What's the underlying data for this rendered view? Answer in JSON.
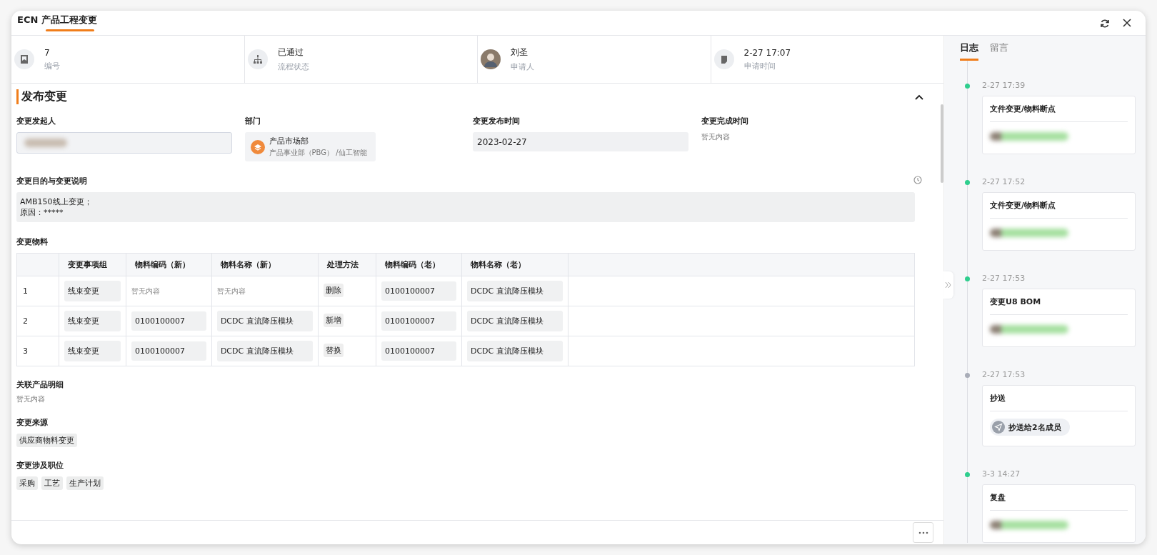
{
  "window": {
    "title": "ECN 产品工程变更"
  },
  "info": [
    {
      "kind": "id",
      "value": "7",
      "label": "编号"
    },
    {
      "kind": "flow",
      "value": "已通过",
      "label": "流程状态"
    },
    {
      "kind": "avatar",
      "value": "刘圣",
      "label": "申请人"
    },
    {
      "kind": "time",
      "value": "2-27 17:07",
      "label": "申请时间"
    }
  ],
  "section": {
    "title": "发布变更",
    "expanded": true
  },
  "fields": [
    {
      "kind": "person",
      "label": "变更发起人"
    },
    {
      "kind": "dept",
      "label": "部门",
      "name": "产品市场部",
      "path": "产品事业部（PBG） /仙工智能"
    },
    {
      "kind": "input",
      "label": "变更发布时间",
      "value": "2023-02-27"
    },
    {
      "kind": "empty",
      "label": "变更完成时间",
      "value": "暂无内容"
    }
  ],
  "purpose": {
    "label": "变更目的与变更说明",
    "lines": [
      "AMB150线上变更；",
      "原因：*****"
    ]
  },
  "materials": {
    "label": "变更物料",
    "columns": [
      "变更事项组",
      "物料编码（新）",
      "物料名称（新）",
      "处理方法",
      "物料编码（老）",
      "物料名称（老）"
    ],
    "rows": [
      {
        "index": "1",
        "cells": [
          {
            "kind": "box",
            "text": "线束变更"
          },
          {
            "kind": "empty",
            "text": "暂无内容"
          },
          {
            "kind": "empty",
            "text": "暂无内容"
          },
          {
            "kind": "tag",
            "text": "删除"
          },
          {
            "kind": "box",
            "text": "0100100007"
          },
          {
            "kind": "box",
            "text": "DCDC 直流降压模块"
          }
        ]
      },
      {
        "index": "2",
        "cells": [
          {
            "kind": "box",
            "text": "线束变更"
          },
          {
            "kind": "box",
            "text": "0100100007"
          },
          {
            "kind": "box",
            "text": "DCDC 直流降压模块"
          },
          {
            "kind": "tag",
            "text": "新增"
          },
          {
            "kind": "box",
            "text": "0100100007"
          },
          {
            "kind": "box",
            "text": "DCDC 直流降压模块"
          }
        ]
      },
      {
        "index": "3",
        "cells": [
          {
            "kind": "box",
            "text": "线束变更"
          },
          {
            "kind": "box",
            "text": "0100100007"
          },
          {
            "kind": "box",
            "text": "DCDC 直流降压模块"
          },
          {
            "kind": "tag",
            "text": "替换"
          },
          {
            "kind": "box",
            "text": "0100100007"
          },
          {
            "kind": "box",
            "text": "DCDC 直流降压模块"
          }
        ]
      }
    ]
  },
  "related": {
    "label": "关联产品明细",
    "value": "暂无内容"
  },
  "source": {
    "label": "变更来源",
    "tags": [
      "供应商物料变更"
    ]
  },
  "positions": {
    "label": "变更涉及职位",
    "tags": [
      "采购",
      "工艺",
      "生产计划"
    ]
  },
  "side_tabs": [
    {
      "label": "日志",
      "selected": true
    },
    {
      "label": "留言",
      "selected": false
    }
  ],
  "log": [
    {
      "time": "2-27 17:39",
      "title": "文件变更/物料断点",
      "color": "#2fce8e",
      "kind": "person"
    },
    {
      "time": "2-27 17:52",
      "title": "文件变更/物料断点",
      "color": "#2fce8e",
      "kind": "person"
    },
    {
      "time": "2-27 17:53",
      "title": "变更U8 BOM",
      "color": "#2fce8e",
      "kind": "person"
    },
    {
      "time": "2-27 17:53",
      "title": "抄送",
      "color": "#a9adb8",
      "kind": "cc",
      "text": "抄送给2名成员"
    },
    {
      "time": "3-3 14:27",
      "title": "复盘",
      "color": "#2fce8e",
      "kind": "person"
    }
  ]
}
